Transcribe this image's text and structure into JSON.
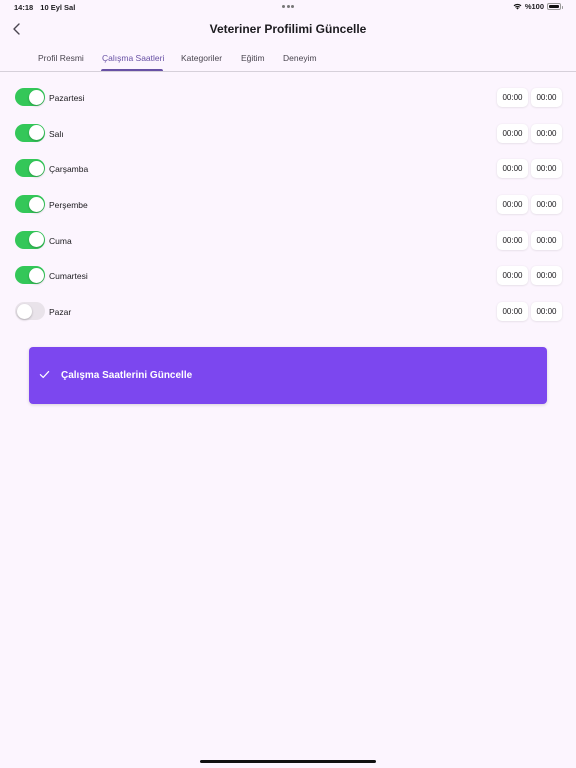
{
  "status_bar": {
    "time": "14:18",
    "date": "10 Eyl Sal",
    "battery_text": "%100",
    "icons": [
      "wifi-icon",
      "battery-icon"
    ]
  },
  "header": {
    "title": "Veteriner Profilimi Güncelle",
    "back_icon": "chevron-left-icon"
  },
  "tabs": [
    {
      "label": "Profil Resmi",
      "active": false
    },
    {
      "label": "Çalışma Saatleri",
      "active": true
    },
    {
      "label": "Kategoriler",
      "active": false
    },
    {
      "label": "Eğitim",
      "active": false
    },
    {
      "label": "Deneyim",
      "active": false
    }
  ],
  "days": [
    {
      "name": "Pazartesi",
      "enabled": true,
      "start": "00:00",
      "end": "00:00"
    },
    {
      "name": "Salı",
      "enabled": true,
      "start": "00:00",
      "end": "00:00"
    },
    {
      "name": "Çarşamba",
      "enabled": true,
      "start": "00:00",
      "end": "00:00"
    },
    {
      "name": "Perşembe",
      "enabled": true,
      "start": "00:00",
      "end": "00:00"
    },
    {
      "name": "Cuma",
      "enabled": true,
      "start": "00:00",
      "end": "00:00"
    },
    {
      "name": "Cumartesi",
      "enabled": true,
      "start": "00:00",
      "end": "00:00"
    },
    {
      "name": "Pazar",
      "enabled": false,
      "start": "00:00",
      "end": "00:00"
    }
  ],
  "update_button": {
    "label": "Çalışma Saatlerini Güncelle",
    "icon": "check-icon"
  },
  "colors": {
    "background": "#fcf5fe",
    "accent": "#7c47ef",
    "tab_active": "#6750a4",
    "switch_on": "#34c759",
    "switch_off": "#e9e3ea"
  }
}
